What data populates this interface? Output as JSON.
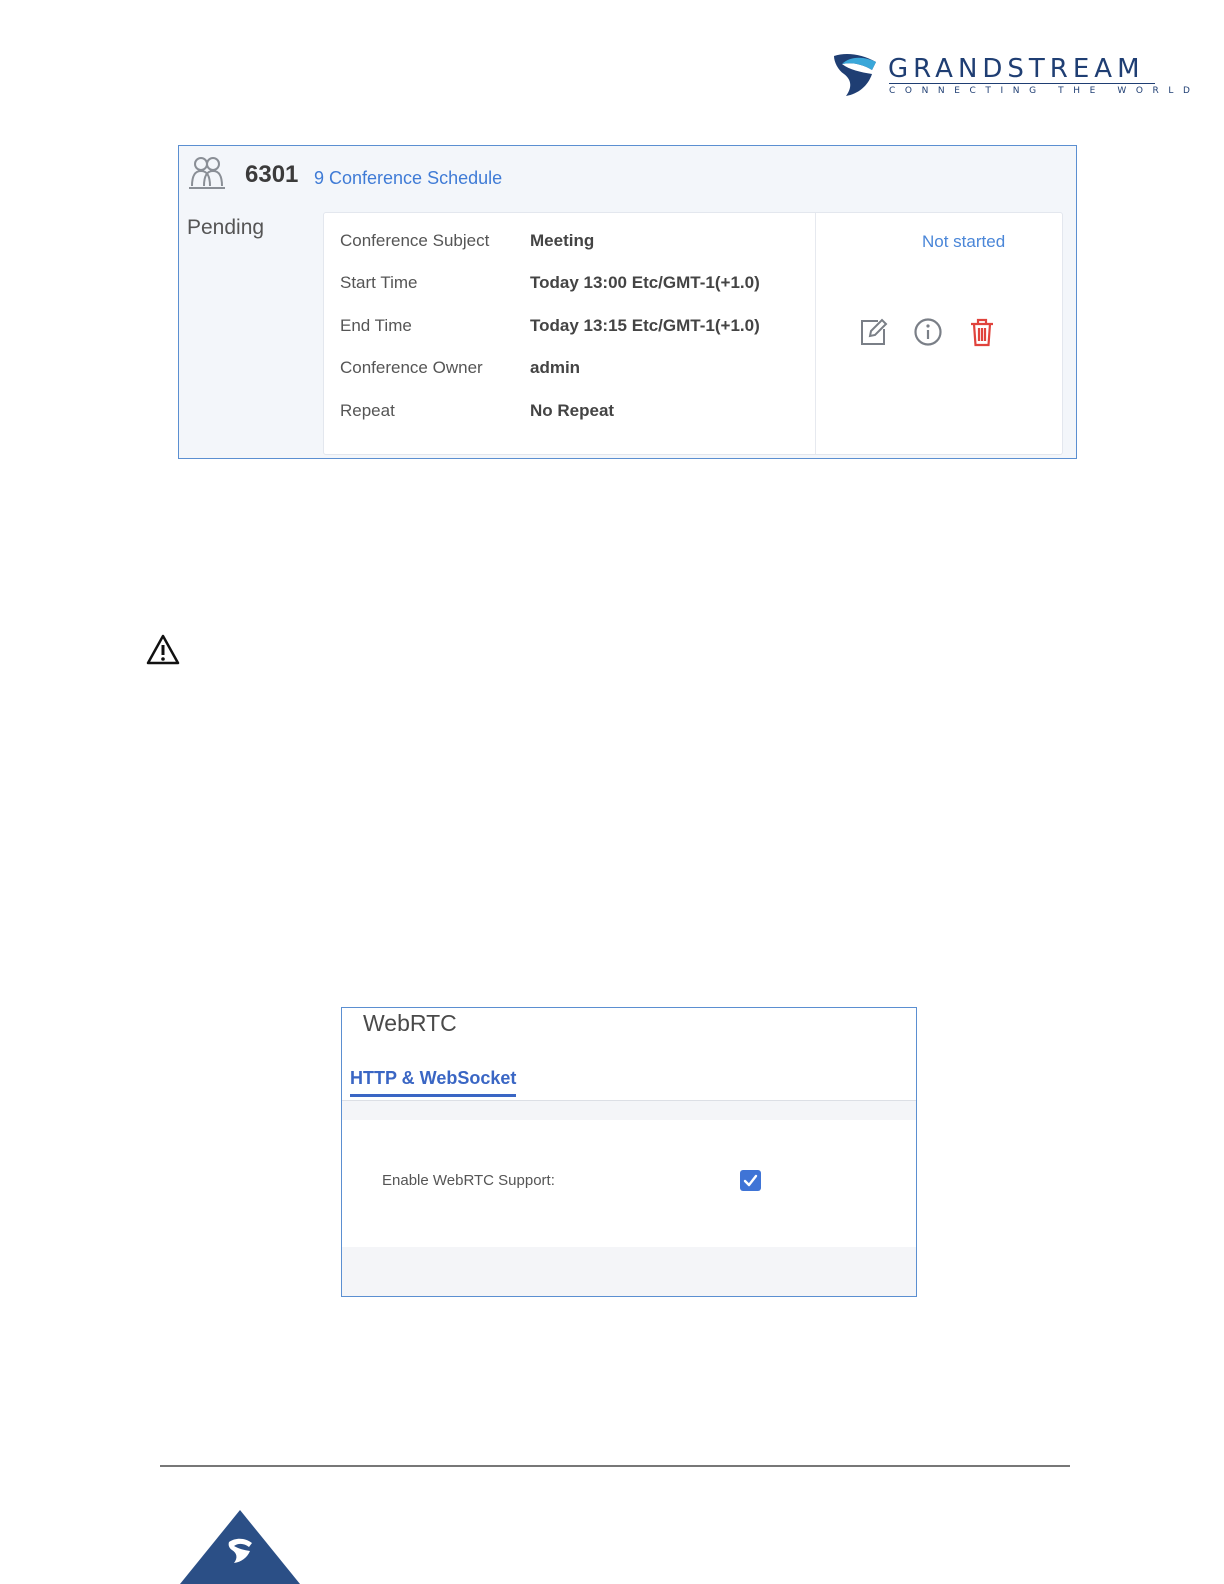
{
  "brand": {
    "name": "GRANDSTREAM",
    "tagline": "CONNECTING THE WORLD",
    "color": "#1f3e73"
  },
  "conference": {
    "number": "6301",
    "schedule_link": "9 Conference Schedule",
    "status_label": "Pending",
    "state": "Not started",
    "fields": [
      {
        "label": "Conference Subject",
        "value": "Meeting"
      },
      {
        "label": "Start Time",
        "value": "Today 13:00 Etc/GMT-1(+1.0)"
      },
      {
        "label": "End Time",
        "value": "Today 13:15 Etc/GMT-1(+1.0)"
      },
      {
        "label": "Conference Owner",
        "value": "admin"
      },
      {
        "label": "Repeat",
        "value": "No Repeat"
      }
    ],
    "actions": [
      {
        "icon": "edit-icon"
      },
      {
        "icon": "info-icon"
      },
      {
        "icon": "trash-icon",
        "color": "#e0433c"
      }
    ]
  },
  "webrtc": {
    "title": "WebRTC",
    "tab": "HTTP & WebSocket",
    "field_label": "Enable WebRTC Support:",
    "enabled": true,
    "accent": "#3a66c4"
  }
}
